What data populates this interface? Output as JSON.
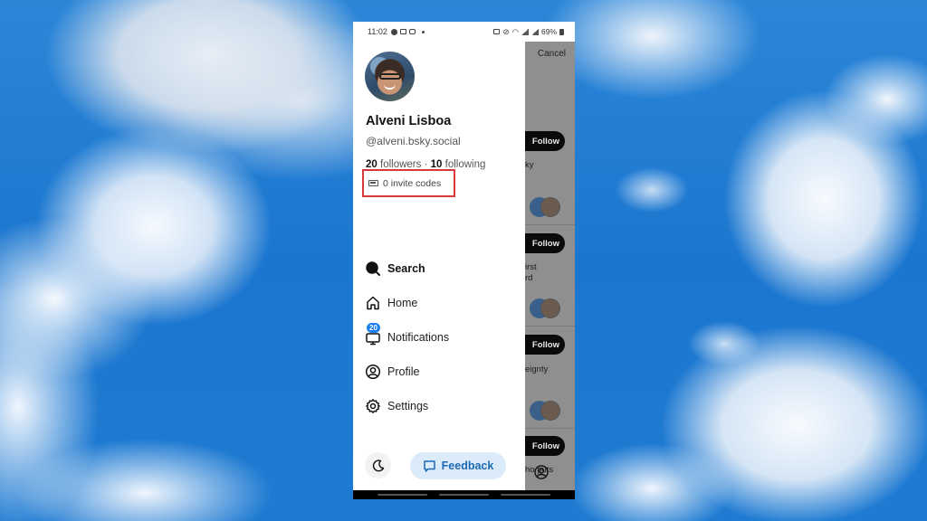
{
  "status_bar": {
    "time": "11:02",
    "battery": "69%"
  },
  "drawer": {
    "profile": {
      "display_name": "Alveni Lisboa",
      "handle": "@alveni.bsky.social",
      "followers_count": "20",
      "followers_label": "followers",
      "separator": "·",
      "following_count": "10",
      "following_label": "following",
      "invite_codes": "0 invite codes",
      "highlight_color": "#d8393c"
    },
    "menu": [
      {
        "label": "Search",
        "icon": "search-icon",
        "active": true
      },
      {
        "label": "Home",
        "icon": "home-icon"
      },
      {
        "label": "Notifications",
        "icon": "bell-icon",
        "badge": "20"
      },
      {
        "label": "Profile",
        "icon": "user-circle-icon"
      },
      {
        "label": "Settings",
        "icon": "gear-icon"
      }
    ],
    "theme_toggle_icon": "moon-icon",
    "feedback_label": "Feedback",
    "accent_color": "#1a7ff0"
  },
  "background_app": {
    "cancel_label": "Cancel",
    "follow_label": "Follow",
    "snippets": [
      "ky",
      "irst",
      "rd",
      "eignty",
      "ho puts"
    ]
  }
}
